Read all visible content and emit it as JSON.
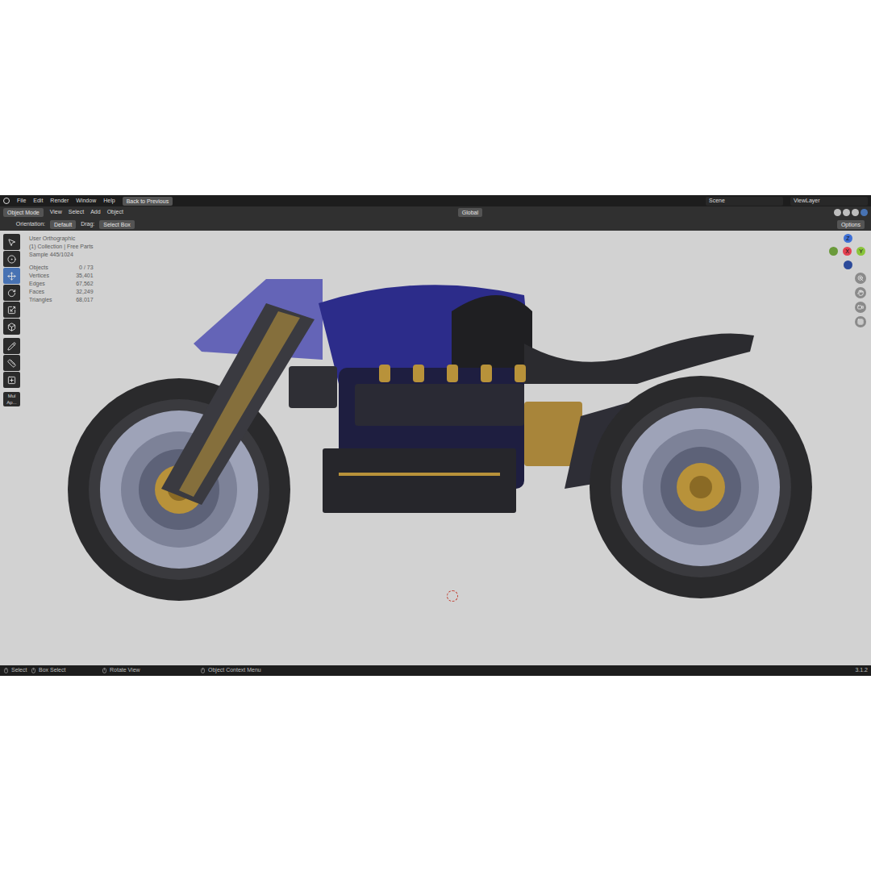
{
  "menu": [
    "File",
    "Edit",
    "Render",
    "Window",
    "Help"
  ],
  "back_button": "Back to Previous",
  "scene": "Scene",
  "view_layer": "ViewLayer",
  "header": {
    "mode": "Object Mode",
    "menus": [
      "View",
      "Select",
      "Add",
      "Object"
    ],
    "orientation": "Global",
    "options": "Options"
  },
  "shading": [
    {
      "selected": false
    },
    {
      "selected": false
    },
    {
      "selected": false
    },
    {
      "selected": true
    }
  ],
  "tool_settings": {
    "orientation_label": "Orientation:",
    "orientation": "Default",
    "drag_label": "Drag:",
    "drag": "Select Box"
  },
  "tools": [
    {
      "selected": false
    },
    {
      "selected": false
    },
    {
      "selected": true
    },
    {
      "selected": false
    },
    {
      "selected": false
    },
    {
      "selected": false
    },
    {
      "selected": false
    },
    {
      "selected": false
    },
    {
      "selected": false
    }
  ],
  "overlay": {
    "view": "User Orthographic",
    "collection": "(1) Collection | Free Parts",
    "sample": "Sample 445/1024",
    "stats": [
      {
        "label": "Objects",
        "value": "0 / 73"
      },
      {
        "label": "Vertices",
        "value": "35,401"
      },
      {
        "label": "Edges",
        "value": "67,562"
      },
      {
        "label": "Faces",
        "value": "32,249"
      },
      {
        "label": "Triangles",
        "value": "68,017"
      }
    ]
  },
  "gizmo": {
    "z": "Z",
    "x": "X",
    "y": "Y"
  },
  "operator_panel": [
    "Mul",
    "Ap..."
  ],
  "status_bar": {
    "items": [
      "Select",
      "Box Select",
      "Rotate View",
      "Object Context Menu"
    ],
    "version": "3.1.2"
  }
}
